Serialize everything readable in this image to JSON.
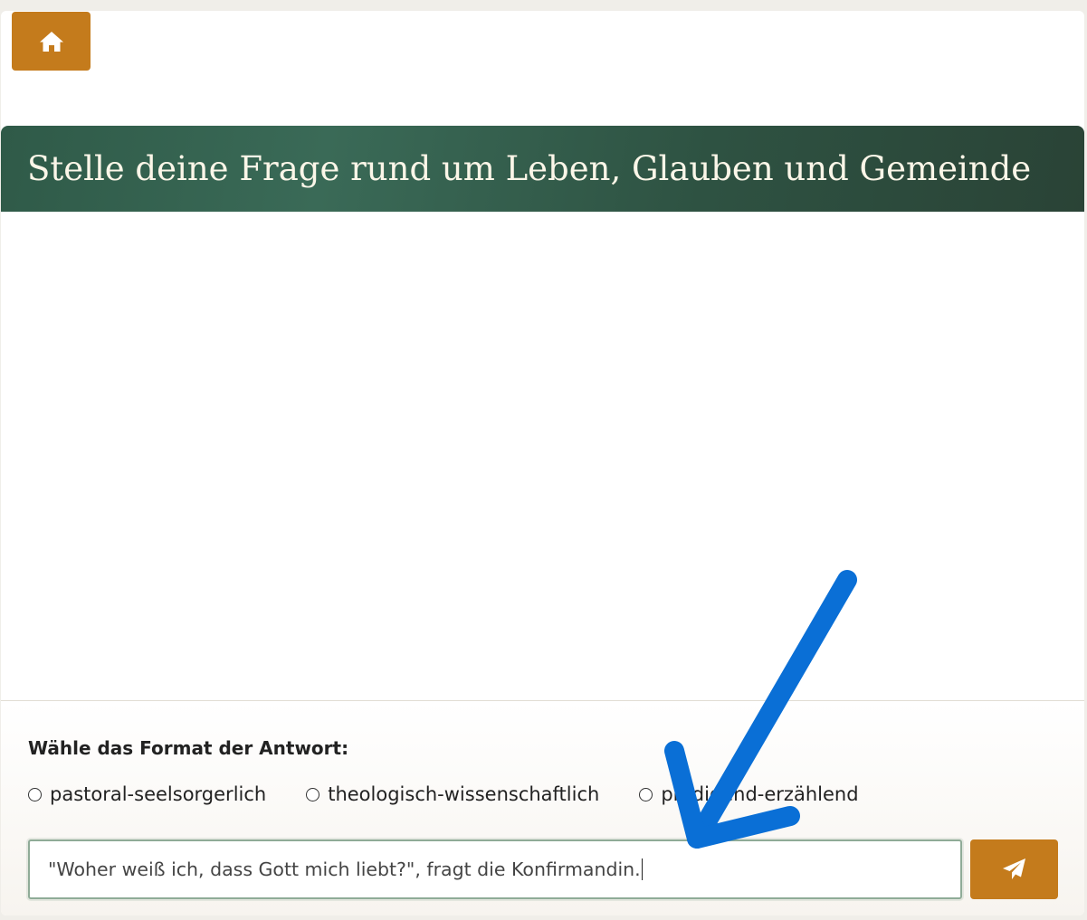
{
  "header": {
    "home_icon": "home-icon"
  },
  "banner": {
    "title": "Stelle deine Frage rund um Leben, Glauben und Gemeinde"
  },
  "form": {
    "format_label": "Wähle das Format der Antwort:",
    "format_options": [
      {
        "label": "pastoral-seelsorgerlich",
        "selected": false
      },
      {
        "label": "theologisch-wissenschaftlich",
        "selected": false
      },
      {
        "label": "predigend-erzählend",
        "selected": false
      }
    ],
    "question_value": "\"Woher weiß ich, dass Gott mich liebt?\", fragt die Konfirmandin.",
    "send_icon": "paper-plane-icon"
  },
  "annotation": {
    "icon": "arrow-down-left-icon",
    "color": "#0a6fd6"
  },
  "colors": {
    "accent": "#c47b1c",
    "banner": "#2f5a48",
    "input_border": "#8fab97"
  }
}
